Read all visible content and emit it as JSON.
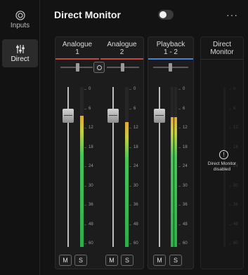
{
  "sidebar": {
    "items": [
      {
        "id": "inputs",
        "label": "Inputs",
        "icon": "inputs-ring-icon",
        "active": false
      },
      {
        "id": "direct",
        "label": "Direct",
        "icon": "mixer-sliders-icon",
        "active": true
      }
    ]
  },
  "header": {
    "title": "Direct Monitor",
    "toggle_on": false,
    "more_label": "···"
  },
  "strips": [
    {
      "line1": "Analogue",
      "line2": "1",
      "color": "#c8463f",
      "meter_level": 0.82,
      "mute": "M",
      "solo": "S"
    },
    {
      "line1": "Analogue",
      "line2": "2",
      "color": "#c8463f",
      "meter_level": 0.78,
      "mute": "M",
      "solo": "S"
    },
    {
      "line1": "Playback",
      "line2": "1 - 2",
      "color": "#4a7fd6",
      "meter_level": 0.81,
      "meter_level_2": 0.81,
      "mute": "M",
      "solo": "S"
    }
  ],
  "direct_monitor_panel": {
    "line1": "Direct",
    "line2": "Monitor",
    "status_line1": "Direct Monitor",
    "status_line2": "disabled",
    "info_icon": "!"
  },
  "scale_labels": [
    "0",
    "6",
    "12",
    "18",
    "24",
    "30",
    "36",
    "48",
    "60"
  ]
}
